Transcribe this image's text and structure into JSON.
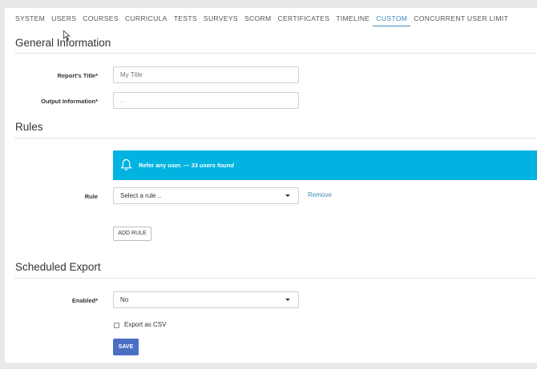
{
  "tabs": [
    "SYSTEM",
    "USERS",
    "COURSES",
    "CURRICULA",
    "TESTS",
    "SURVEYS",
    "SCORM",
    "CERTIFICATES",
    "TIMELINE",
    "CUSTOM",
    "CONCURRENT USER LIMIT"
  ],
  "active_tab": "CUSTOM",
  "general": {
    "title": "General Information",
    "report_title_label": "Report's Title*",
    "report_title_placeholder": "My Title",
    "output_label": "Output Information*",
    "output_value": ".."
  },
  "rules": {
    "title": "Rules",
    "alert_prefix": "Refer any user.",
    "alert_dash": " — ",
    "alert_count": "33 users found",
    "rule_label": "Rule",
    "rule_select": "Select a rule ..",
    "remove_label": "Remove",
    "add_rule_label": "ADD RULE"
  },
  "export": {
    "title": "Scheduled Export",
    "enabled_label": "Enabled*",
    "enabled_value": "No",
    "csv_label": "Export as CSV",
    "save_label": "SAVE"
  },
  "colors": {
    "accent": "#3c8dbc",
    "alert": "#00b3e0",
    "primary_button": "#4a6fc4"
  }
}
